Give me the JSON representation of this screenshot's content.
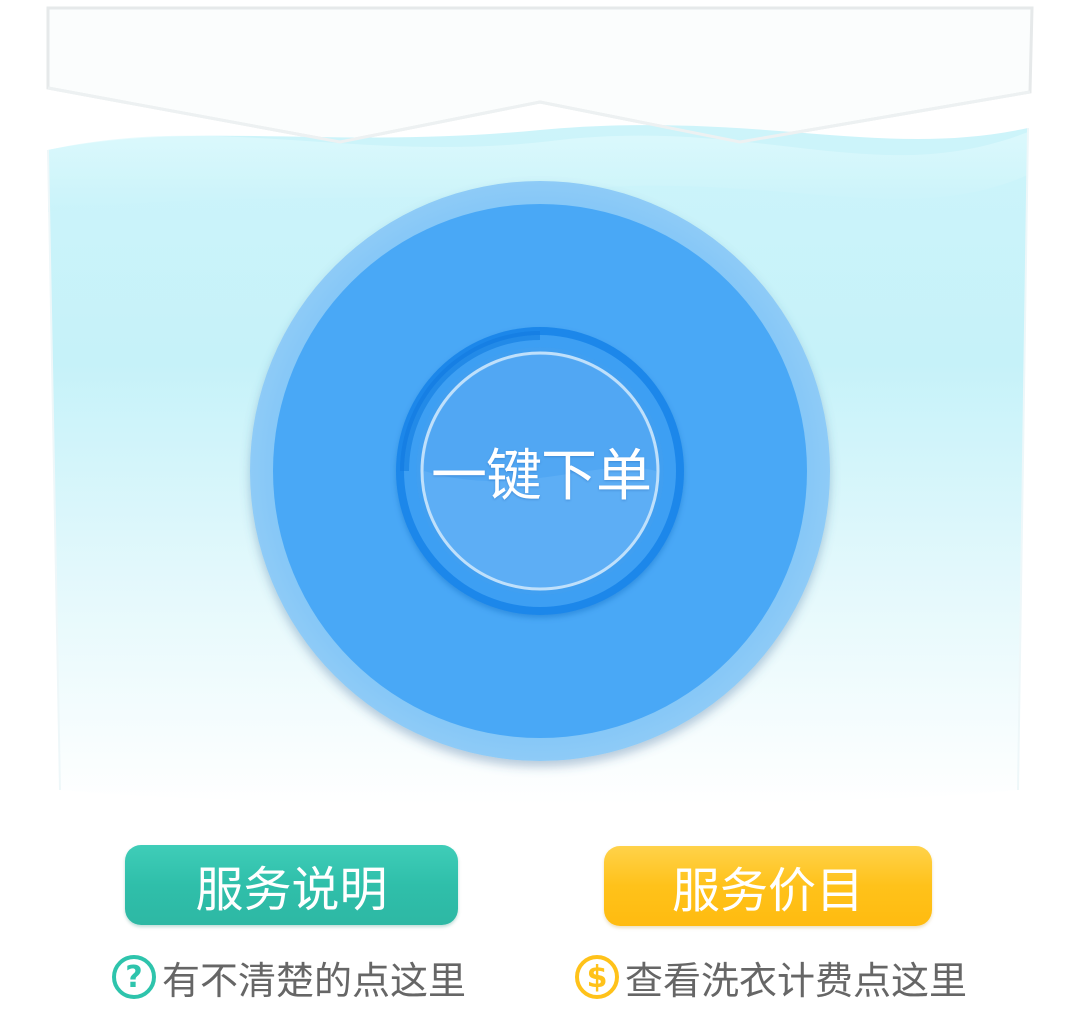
{
  "order": {
    "label": "一键下单"
  },
  "actions": {
    "service_info_label": "服务说明",
    "service_price_label": "服务价目"
  },
  "help": {
    "info_text": "有不清楚的点这里",
    "info_icon": "question-icon",
    "info_icon_glyph": "?",
    "price_text": "查看洗衣计费点这里",
    "price_icon": "dollar-icon",
    "price_icon_glyph": "$"
  },
  "colors": {
    "water_top": "#d6f6fb",
    "water_bottom": "#ffffff",
    "order_outer": "#7dc2f6",
    "order_main": "#4aa8f6",
    "order_ring": "#1a85e8",
    "order_core": "#5aaef5",
    "service_info_accent": "#2ec4ac",
    "service_price_accent": "#ffc21a",
    "help_text": "#666666"
  }
}
